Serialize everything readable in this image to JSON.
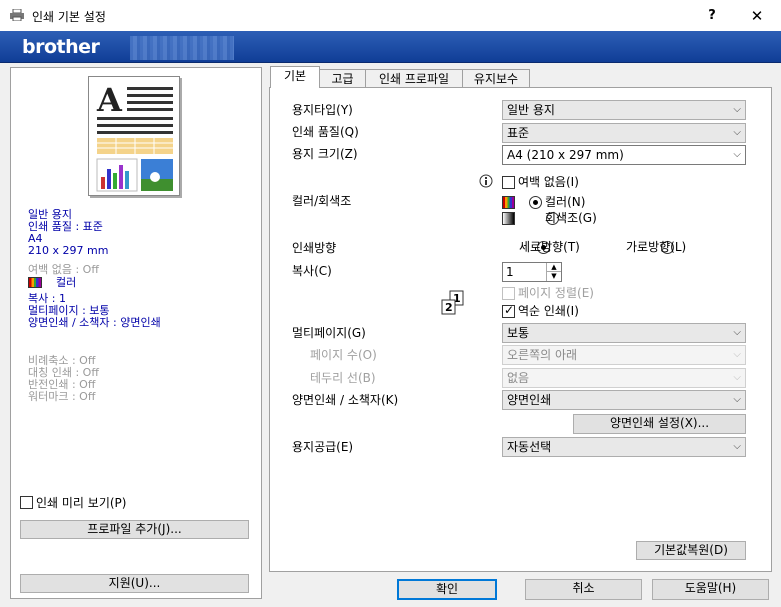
{
  "window": {
    "title": "인쇄 기본 설정",
    "help": "?",
    "close": "✕"
  },
  "banner": {
    "logo": "brother"
  },
  "summary": {
    "blue": [
      "일반 용지",
      "인쇄 품질 : 표준",
      "A4",
      "210 x 297 mm"
    ],
    "grey1": "여백 없음 : Off",
    "color": "컬러",
    "blue2": [
      "복사 : 1",
      "멀티페이지 : 보통",
      "양면인쇄 / 소책자 : 양면인쇄"
    ],
    "grey2": [
      "비례축소 : Off",
      "대칭 인쇄 : Off",
      "반전인쇄 : Off",
      "워터마크 : Off"
    ]
  },
  "left": {
    "preview_label": "인쇄 미리 보기(P)",
    "add_profile": "프로파일 추가(J)...",
    "support": "지원(U)..."
  },
  "tabs": [
    "기본",
    "고급",
    "인쇄 프로파일",
    "유지보수"
  ],
  "form": {
    "media_type_label": "용지타입(Y)",
    "media_type": "일반 용지",
    "quality_label": "인쇄 품질(Q)",
    "quality": "표준",
    "paper_size_label": "용지 크기(Z)",
    "paper_size": "A4 (210 x 297 mm)",
    "borderless": "여백 없음(I)",
    "color_label": "컬러/회색조",
    "color_opt": "컬러(N)",
    "gray_opt": "회색조(G)",
    "orient_label": "인쇄방향",
    "portrait": "세로방향(T)",
    "landscape": "가로방향(L)",
    "copies_label": "복사(C)",
    "copies": "1",
    "collate": "페이지 정렬(E)",
    "reverse": "역순 인쇄(I)",
    "multipage_label": "멀티페이지(G)",
    "multipage": "보통",
    "pages_label": "페이지 수(O)",
    "pages": "오른쪽의 아래",
    "border_label": "테두리 선(B)",
    "border": "없음",
    "duplex_label": "양면인쇄 / 소책자(K)",
    "duplex": "양면인쇄",
    "duplex_settings": "양면인쇄 설정(X)...",
    "source_label": "용지공급(E)",
    "source": "자동선택",
    "defaults": "기본값복원(D)"
  },
  "footer": {
    "ok": "확인",
    "cancel": "취소",
    "help": "도움말(H)"
  }
}
